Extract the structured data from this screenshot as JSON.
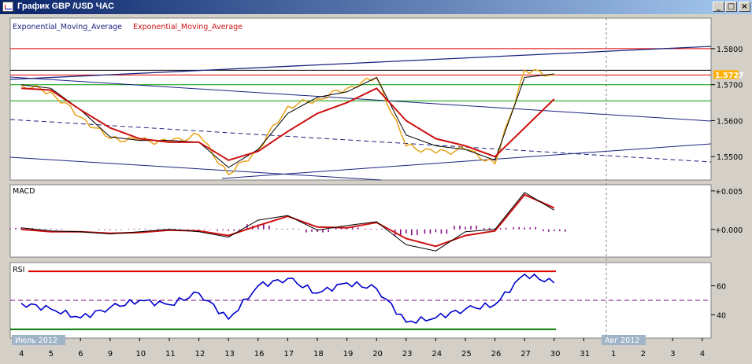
{
  "window": {
    "title": "График GBP /USD ЧАС",
    "minimize_glyph": "_",
    "maximize_glyph": "□",
    "close_glyph": "×"
  },
  "main_panel": {
    "indicator_label_1": "Exponential_Moving_Average",
    "indicator_label_2": "Exponential_Moving_Average",
    "current_price": "1.5727",
    "price_labels": [
      "1.5800",
      "1.5700",
      "1.5600",
      "1.5500"
    ]
  },
  "macd_panel": {
    "label": "MACD",
    "labels": [
      "+0.005",
      "+0.000"
    ]
  },
  "rsi_panel": {
    "label": "RSI",
    "labels": [
      "60",
      "40"
    ]
  },
  "x_axis": {
    "day_labels": [
      "4",
      "5",
      "6",
      "9",
      "10",
      "11",
      "12",
      "13",
      "16",
      "17",
      "18",
      "19",
      "20",
      "23",
      "24",
      "25",
      "26",
      "27",
      "30",
      "31",
      "1",
      "2",
      "3",
      "4"
    ],
    "month_labels": [
      "Июль 2012",
      "Авг 2012"
    ]
  },
  "colors": {
    "background": "#ffffff",
    "frame": "#d4d0c8",
    "price": "#e8a317",
    "ema_fast": "#000000",
    "ema_slow": "#cc1111",
    "trendline": "#1a237e",
    "macd_histogram": "#800080",
    "rsi_line": "#0000cc",
    "rsi_overbought": "#dd0000",
    "rsi_oversold": "#007700",
    "current_price_tag": "#ffb000",
    "month_tag": "#a0b4c8"
  },
  "chart_data": [
    {
      "type": "line",
      "title": "GBP/USD 1H",
      "x": [
        "4",
        "5",
        "6",
        "9",
        "10",
        "11",
        "12",
        "13",
        "16",
        "17",
        "18",
        "19",
        "20",
        "23",
        "24",
        "25",
        "26",
        "27",
        "30"
      ],
      "series": [
        {
          "name": "Exponential_Moving_Average",
          "values": [
            1.57,
            1.569,
            1.563,
            1.5555,
            1.5545,
            1.5545,
            1.554,
            1.547,
            1.552,
            1.562,
            1.5665,
            1.568,
            1.572,
            1.556,
            1.553,
            1.552,
            1.549,
            1.572,
            1.573
          ]
        },
        {
          "name": "Exponential_Moving_Average",
          "values": [
            1.569,
            1.5685,
            1.563,
            1.558,
            1.555,
            1.554,
            1.554,
            1.549,
            1.5515,
            1.557,
            1.562,
            1.565,
            1.569,
            1.56,
            1.555,
            1.553,
            1.55,
            1.558,
            1.566
          ]
        }
      ],
      "price_points": [
        1.57,
        1.568,
        1.561,
        1.555,
        1.5545,
        1.554,
        1.556,
        1.545,
        1.552,
        1.564,
        1.566,
        1.569,
        1.572,
        1.553,
        1.551,
        1.552,
        1.548,
        1.574,
        1.5727
      ],
      "horizontal_levels": [
        1.58,
        1.574,
        1.5727,
        1.57,
        1.5655
      ],
      "ylim": [
        1.5435,
        1.5885
      ],
      "y_ticks": [
        1.55,
        1.56,
        1.57,
        1.58
      ],
      "current_price": 1.5727,
      "legend": "top-left",
      "grid": false
    },
    {
      "type": "line",
      "title": "MACD",
      "x": [
        "4",
        "5",
        "6",
        "9",
        "10",
        "11",
        "12",
        "13",
        "16",
        "17",
        "18",
        "19",
        "20",
        "23",
        "24",
        "25",
        "26",
        "27",
        "30"
      ],
      "series": [
        {
          "values": [
            0.0002,
            -0.0002,
            -0.0003,
            -0.0006,
            -0.0003,
            0.0,
            -0.0003,
            -0.001,
            0.0012,
            0.0018,
            -0.0001,
            0.0005,
            0.001,
            -0.002,
            -0.0028,
            -0.0003,
            0.0,
            0.0048,
            0.0025
          ]
        },
        {
          "values": [
            0.0,
            -0.0003,
            -0.0003,
            -0.0005,
            -0.0004,
            -0.0001,
            -0.0002,
            -0.0008,
            0.0005,
            0.0017,
            0.0003,
            0.0002,
            0.0009,
            -0.0012,
            -0.0022,
            -0.0008,
            -0.0002,
            0.0045,
            0.0028
          ]
        }
      ],
      "histogram": [
        0.0002,
        0.0001,
        0.0,
        -0.0001,
        0.0001,
        0.0001,
        -0.0001,
        -0.0002,
        0.0007,
        0.0001,
        -0.0004,
        0.0003,
        0.0001,
        -0.0008,
        -0.0006,
        0.0005,
        0.0002,
        0.0003,
        -0.0003
      ],
      "ylim": [
        -0.0036,
        0.0058
      ],
      "y_ticks": [
        0.0,
        0.005
      ]
    },
    {
      "type": "line",
      "title": "RSI",
      "x": [
        "4",
        "5",
        "6",
        "9",
        "10",
        "11",
        "12",
        "13",
        "16",
        "17",
        "18",
        "19",
        "20",
        "23",
        "24",
        "25",
        "26",
        "27",
        "30"
      ],
      "series": [
        {
          "values": [
            48,
            44,
            38,
            45,
            50,
            47,
            55,
            37,
            60,
            65,
            55,
            62,
            58,
            35,
            38,
            44,
            47,
            68,
            62
          ]
        }
      ],
      "levels": [
        70,
        50,
        30
      ],
      "ylim": [
        24,
        76
      ],
      "y_ticks": [
        40,
        60
      ]
    }
  ]
}
